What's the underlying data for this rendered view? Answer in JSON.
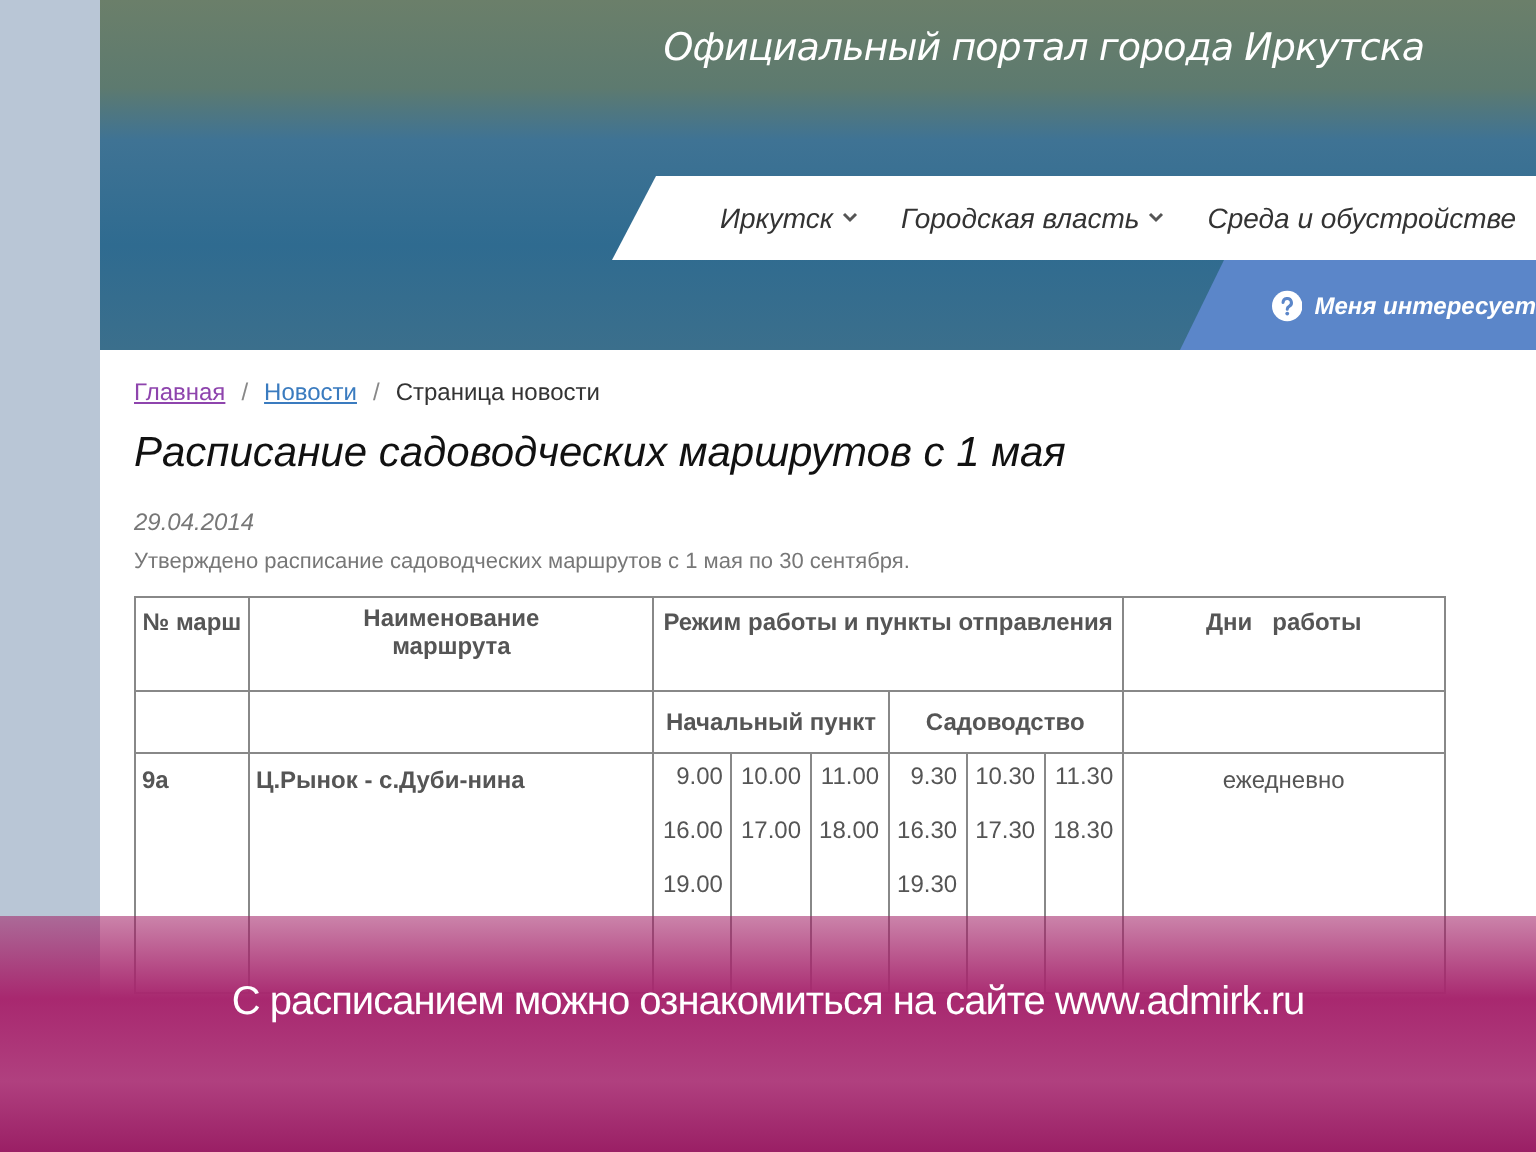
{
  "header": {
    "title": "Официальный портал города Иркутска"
  },
  "nav": {
    "items": [
      {
        "label": "Иркутск",
        "dropdown": true
      },
      {
        "label": "Городская власть",
        "dropdown": true
      },
      {
        "label": "Среда и обустройстве",
        "dropdown": false
      }
    ]
  },
  "interest_button": {
    "label": "Меня интересует"
  },
  "breadcrumbs": [
    {
      "label": "Главная",
      "kind": "visited"
    },
    {
      "label": "/",
      "kind": "separator"
    },
    {
      "label": "Новости",
      "kind": "link"
    },
    {
      "label": "/",
      "kind": "separator"
    },
    {
      "label": "Страница новости",
      "kind": "current"
    }
  ],
  "article": {
    "title": "Расписание садоводческих маршрутов с 1 мая",
    "date": "29.04.2014",
    "lead": "Утверждено расписание садоводческих маршрутов с 1 мая по 30 сентября."
  },
  "table": {
    "columns": [
      "№ марш",
      "Наименование маршрута",
      "Режим работы и пункты отправления",
      "Дни   работы"
    ],
    "subcolumns": [
      "Начальный пункт",
      "Садоводство"
    ],
    "rows": [
      {
        "number": "9а",
        "name": "Ц.Рынок - с.Дуби-нина",
        "start_times": [
          [
            "9.00",
            "16.00",
            "19.00"
          ],
          [
            "10.00",
            "17.00"
          ],
          [
            "11.00",
            "18.00"
          ]
        ],
        "garden_times": [
          [
            "9.30",
            "16.30",
            "19.30"
          ],
          [
            "10.30",
            "17.30"
          ],
          [
            "11.30",
            "18.30"
          ]
        ],
        "days": "ежедневно"
      }
    ]
  },
  "caption": {
    "text": "С расписанием можно ознакомиться на сайте www.admirk.ru"
  }
}
